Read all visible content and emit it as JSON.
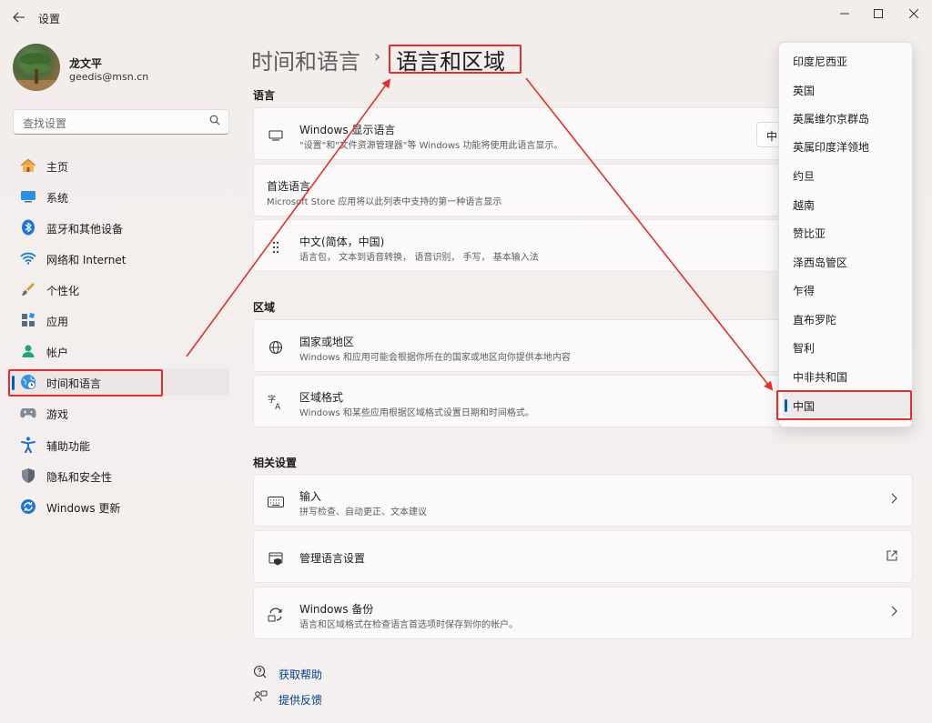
{
  "window": {
    "title": "设置",
    "controls": {
      "minimize": "─",
      "maximize": "☐",
      "close": "✕"
    }
  },
  "profile": {
    "name": "龙文平",
    "email": "geedis@msn.cn"
  },
  "search": {
    "placeholder": "查找设置"
  },
  "sidebar": {
    "items": [
      {
        "label": "主页",
        "icon": "home-icon"
      },
      {
        "label": "系统",
        "icon": "system-icon"
      },
      {
        "label": "蓝牙和其他设备",
        "icon": "bluetooth-icon"
      },
      {
        "label": "网络和 Internet",
        "icon": "wifi-icon"
      },
      {
        "label": "个性化",
        "icon": "brush-icon"
      },
      {
        "label": "应用",
        "icon": "apps-icon"
      },
      {
        "label": "帐户",
        "icon": "account-icon"
      },
      {
        "label": "时间和语言",
        "icon": "globe-clock-icon",
        "active": true
      },
      {
        "label": "游戏",
        "icon": "gamepad-icon"
      },
      {
        "label": "辅助功能",
        "icon": "accessibility-icon"
      },
      {
        "label": "隐私和安全性",
        "icon": "shield-icon"
      },
      {
        "label": "Windows 更新",
        "icon": "update-icon"
      }
    ]
  },
  "header": {
    "breadcrumb_parent": "时间和语言",
    "separator": "›",
    "breadcrumb_current": "语言和区域"
  },
  "sections": {
    "language": "语言",
    "region": "区域",
    "related": "相关设置"
  },
  "cards": {
    "display_language": {
      "title": "Windows 显示语言",
      "subtitle": "\"设置\"和\"文件资源管理器\"等 Windows 功能将使用此语言显示。",
      "value": "中"
    },
    "preferred_language": {
      "title": "首选语言",
      "subtitle": "Microsoft Store 应用将以此列表中支持的第一种语言显示"
    },
    "chinese": {
      "title": "中文(简体，中国)",
      "subtitle": "语言包，  文本到语音转换，  语音识别，  手写，  基本输入法"
    },
    "country": {
      "title": "国家或地区",
      "subtitle": "Windows 和应用可能会根据你所在的国家或地区向你提供本地内容"
    },
    "regional_format": {
      "title": "区域格式",
      "subtitle": "Windows 和某些应用根据区域格式设置日期和时间格式。"
    },
    "input": {
      "title": "输入",
      "subtitle": "拼写检查、自动更正、文本建议"
    },
    "manage_language": {
      "title": "管理语言设置"
    },
    "backup": {
      "title": "Windows 备份",
      "subtitle": "语言和区域格式在检查语言首选项时保存到你的帐户。"
    }
  },
  "dropdown": {
    "items": [
      "印度尼西亚",
      "英国",
      "英属维尔京群岛",
      "英属印度洋领地",
      "约旦",
      "越南",
      "赞比亚",
      "泽西岛管区",
      "乍得",
      "直布罗陀",
      "智利",
      "中非共和国",
      "中国"
    ],
    "selected": "中国"
  },
  "footer": {
    "help": "获取帮助",
    "feedback": "提供反馈"
  },
  "colors": {
    "accent": "#005fb8",
    "highlight": "#e0312f",
    "link": "#003e92"
  }
}
